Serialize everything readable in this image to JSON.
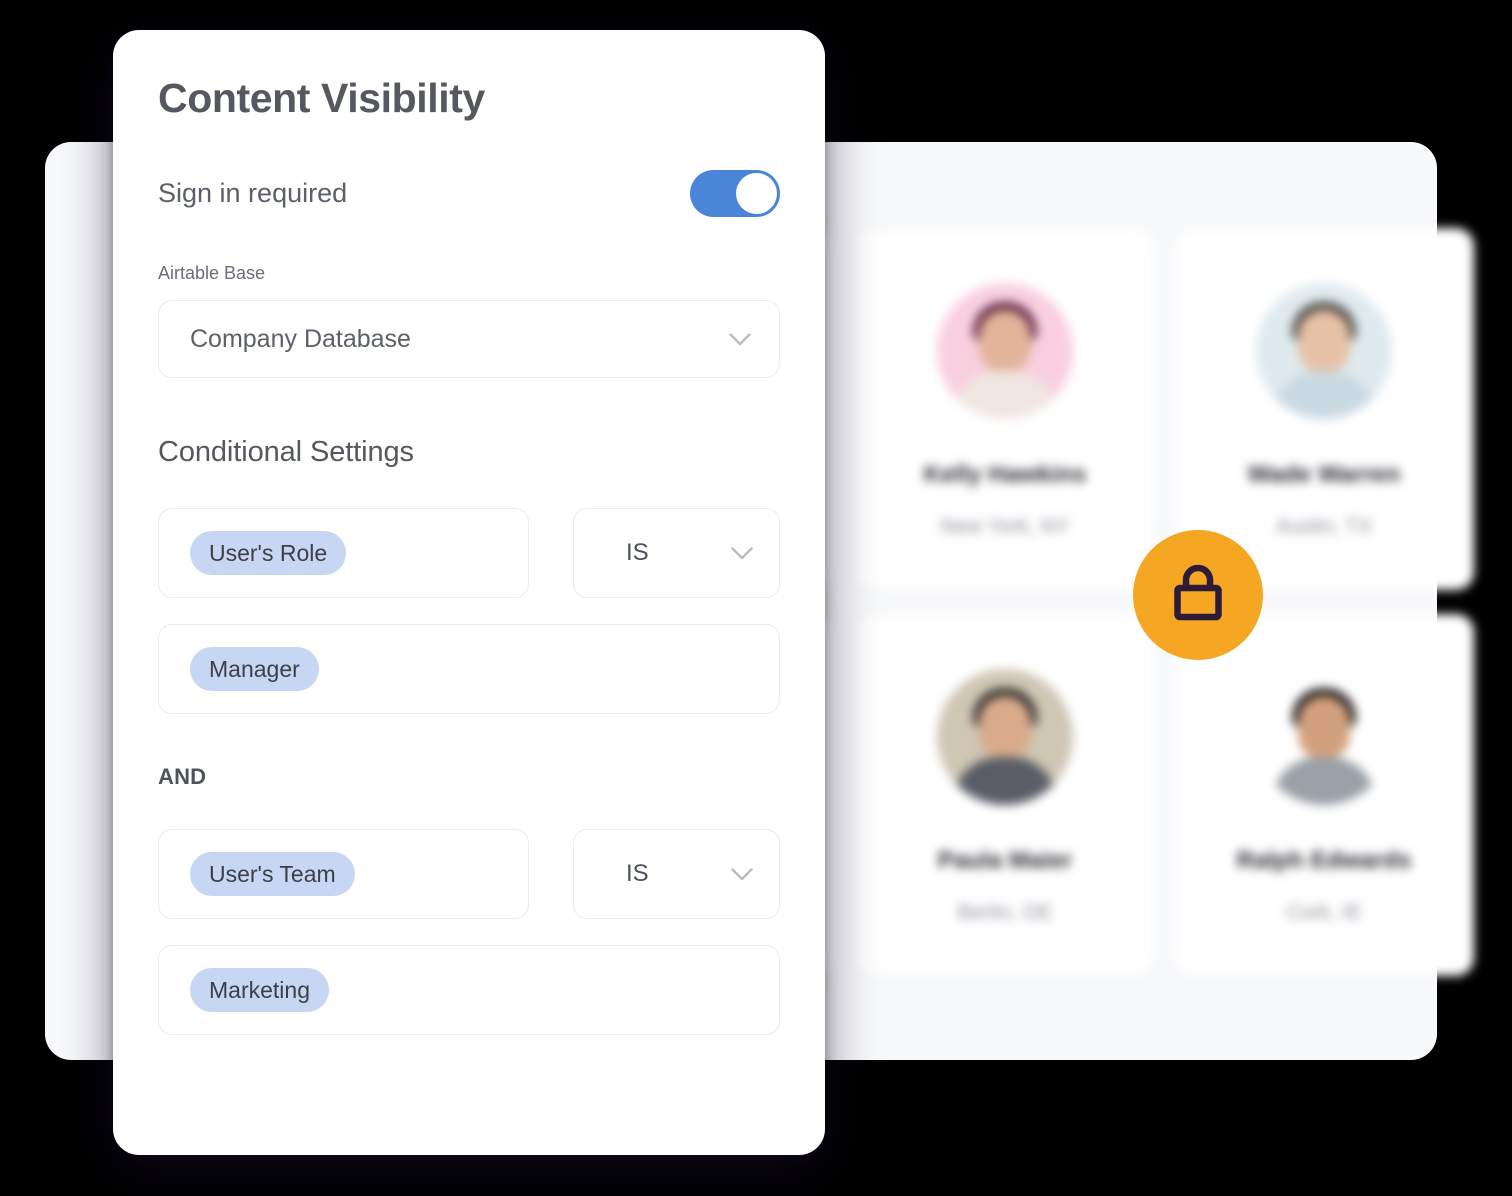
{
  "modal": {
    "title": "Content Visibility",
    "sign_in": {
      "label": "Sign in required",
      "toggle_state": "on",
      "accent_color": "#4a85d8"
    },
    "airtable_base": {
      "label": "Airtable Base",
      "value": "Company Database",
      "chevron": "chevron-down-icon"
    },
    "conditional_settings": {
      "title": "Conditional Settings",
      "join_operator": "AND",
      "conditions": [
        {
          "field": "User's Role",
          "operator": "IS",
          "value": "Manager"
        },
        {
          "field": "User's Team",
          "operator": "IS",
          "value": "Marketing"
        }
      ],
      "chip_color": "#c7d6f2"
    }
  },
  "background": {
    "lock_badge": {
      "icon": "lock-icon",
      "background_color": "#f5a623",
      "icon_color": "#2d1b38"
    },
    "profile_cards": [
      {
        "name": "Kelly Hawkins",
        "location": "New York, NY",
        "avatar_bg": "#f9cfe0",
        "hair": "#5b2340",
        "skin": "#e2b49a",
        "body": "#efe6e2"
      },
      {
        "name": "Wade Warren",
        "location": "Austin, TX",
        "avatar_bg": "#dfeaee",
        "hair": "#4a4540",
        "skin": "#e6c1a6",
        "body": "#c9d9e2"
      },
      {
        "name": "Paula Maier",
        "location": "Berlin, DE",
        "avatar_bg": "#cfc6b4",
        "hair": "#2e2a28",
        "skin": "#d9ab8c",
        "body": "#5a5d66"
      },
      {
        "name": "Ralph Edwards",
        "location": "Cork, IE",
        "avatar_bg": "#ffffff",
        "hair": "#1c1a1a",
        "skin": "#d3a07d",
        "body": "#9aa0a6"
      }
    ]
  }
}
